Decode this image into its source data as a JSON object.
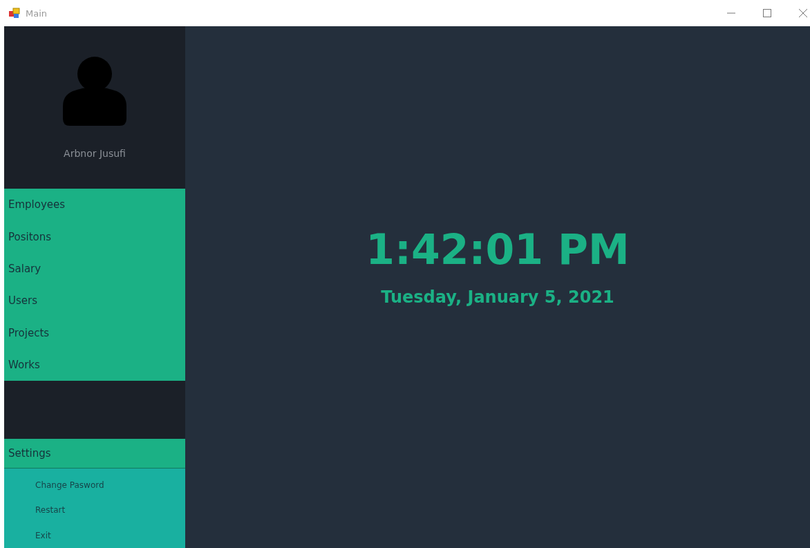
{
  "window": {
    "title": "Main"
  },
  "profile": {
    "name": "Arbnor Jusufi"
  },
  "menu": [
    {
      "label": "Employees"
    },
    {
      "label": "Positons"
    },
    {
      "label": "Salary"
    },
    {
      "label": "Users"
    },
    {
      "label": "Projects"
    },
    {
      "label": "Works"
    }
  ],
  "settings": {
    "label": "Settings",
    "expanded": true,
    "items": [
      {
        "label": "Change Pasword"
      },
      {
        "label": "Restart"
      },
      {
        "label": "Exit"
      }
    ]
  },
  "clock": {
    "time": "1:42:01 PM",
    "date": "Tuesday, January 5, 2021"
  }
}
